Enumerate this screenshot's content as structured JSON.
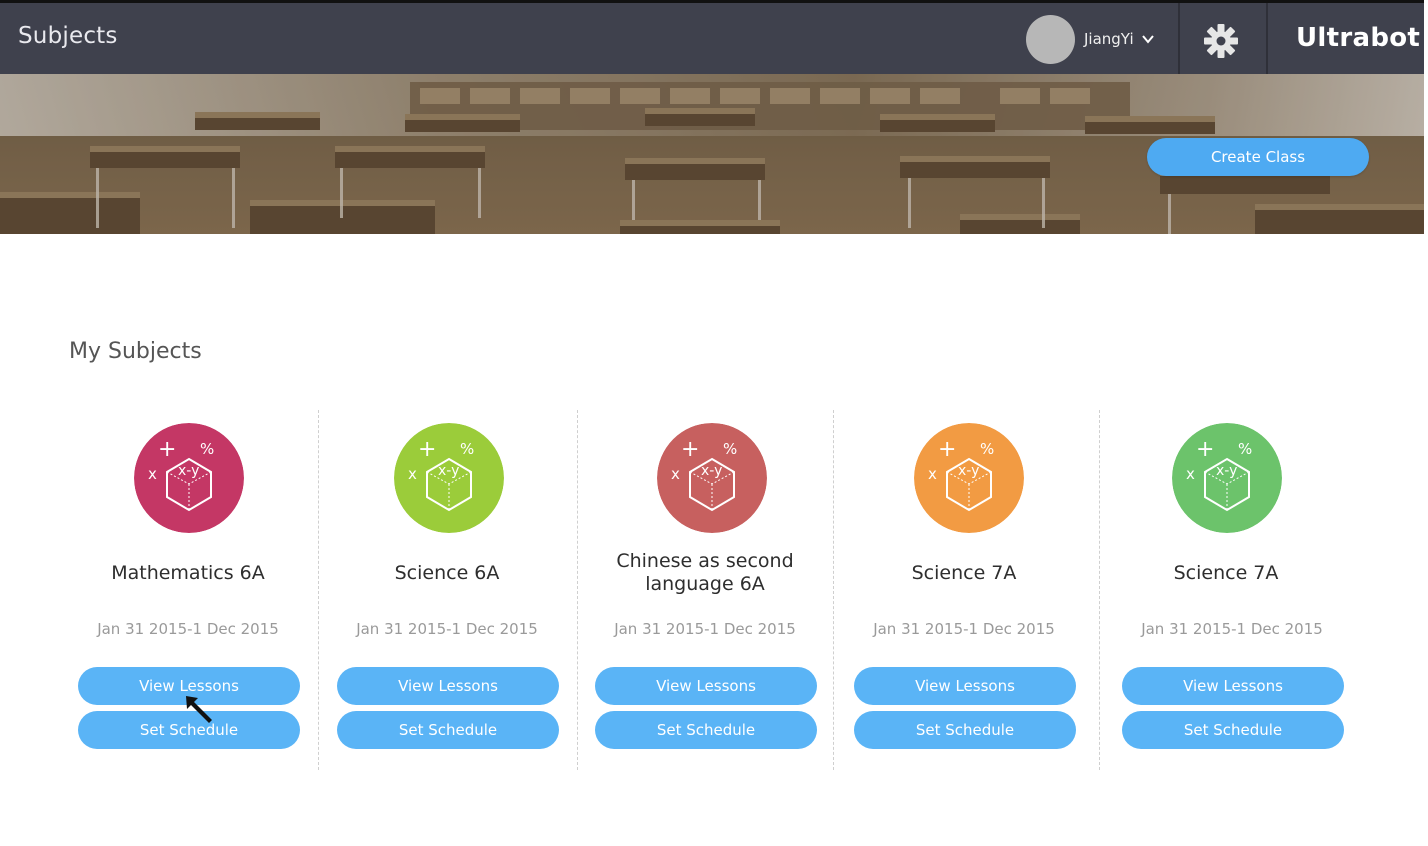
{
  "header": {
    "page_title": "Subjects",
    "user_name": "JiangYi",
    "brand": "Ultrabot",
    "icons": {
      "avatar": "avatar",
      "dropdown": "chevron-down-icon",
      "settings": "gear-icon"
    }
  },
  "banner": {
    "create_class_label": "Create Class"
  },
  "main": {
    "section_title": "My Subjects",
    "subjects": [
      {
        "name": "Mathematics 6A",
        "dates": "Jan 31 2015-1 Dec 2015",
        "color": "#c43765",
        "view_label": "View Lessons",
        "schedule_label": "Set Schedule"
      },
      {
        "name": "Science 6A",
        "dates": "Jan 31 2015-1 Dec 2015",
        "color": "#9bcc3a",
        "view_label": "View Lessons",
        "schedule_label": "Set Schedule"
      },
      {
        "name": "Chinese as second language 6A",
        "dates": "Jan 31 2015-1 Dec 2015",
        "color": "#c7605f",
        "view_label": "View Lessons",
        "schedule_label": "Set Schedule"
      },
      {
        "name": "Science 7A",
        "dates": "Jan 31 2015-1 Dec 2015",
        "color": "#f29b43",
        "view_label": "View Lessons",
        "schedule_label": "Set Schedule"
      },
      {
        "name": "Science 7A",
        "dates": "Jan 31 2015-1 Dec 2015",
        "color": "#6cc36b",
        "view_label": "View Lessons",
        "schedule_label": "Set Schedule"
      }
    ]
  },
  "colors": {
    "topbar": "#3f414d",
    "button": "#5ab4f6",
    "create_button": "#4eaaf2"
  }
}
